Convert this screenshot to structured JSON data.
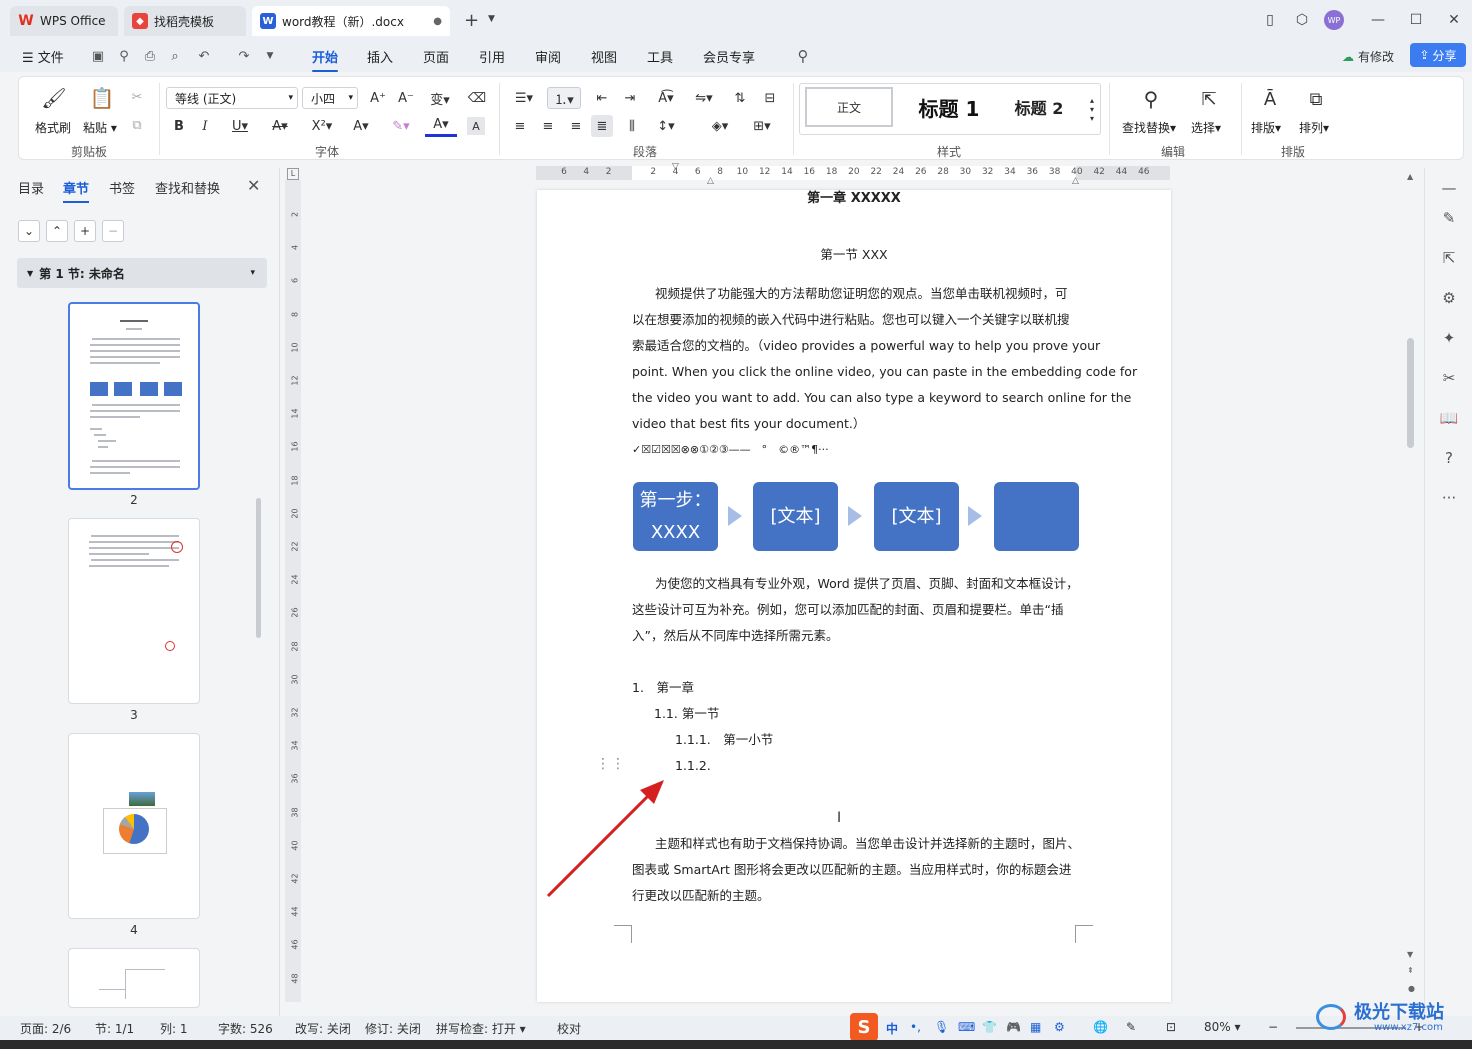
{
  "tabs": [
    {
      "label": "WPS Office",
      "logo": "W"
    },
    {
      "label": "找稻壳模板"
    },
    {
      "label": "word教程（新）.docx",
      "logo": "W"
    }
  ],
  "avatar": "WP",
  "menu": {
    "file": "文件",
    "items": [
      "开始",
      "插入",
      "页面",
      "引用",
      "审阅",
      "视图",
      "工具",
      "会员专享"
    ],
    "has_changes": "有修改",
    "share": "分享"
  },
  "ribbon": {
    "clipboard": {
      "format_painter": "格式刷",
      "paste": "粘贴",
      "section": "剪贴板"
    },
    "font": {
      "name": "等线 (正文)",
      "size": "小四",
      "section": "字体"
    },
    "paragraph": {
      "section": "段落"
    },
    "styles": {
      "normal": "正文",
      "heading1": "标题 1",
      "heading2": "标题 2",
      "section": "样式"
    },
    "edit": {
      "find_replace": "查找替换",
      "select": "选择",
      "section": "编辑"
    },
    "layout": {
      "typeset": "排版",
      "arrange": "排列",
      "section": "排版"
    }
  },
  "leftpanel": {
    "tabs": [
      "目录",
      "章节",
      "书签",
      "查找和替换"
    ],
    "section_title": "第 1 节: 未命名",
    "pages": [
      "2",
      "3",
      "4"
    ]
  },
  "ruler": {
    "h": [
      "6",
      "4",
      "2",
      "",
      "2",
      "4",
      "6",
      "8",
      "10",
      "12",
      "14",
      "16",
      "18",
      "20",
      "22",
      "24",
      "26",
      "28",
      "30",
      "32",
      "34",
      "36",
      "38",
      "40",
      "42",
      "44",
      "46"
    ],
    "v": [
      "2",
      "4",
      "6",
      "8",
      "10",
      "12",
      "14",
      "16",
      "18",
      "20",
      "22",
      "24",
      "26",
      "28",
      "30",
      "32",
      "34",
      "36",
      "38",
      "40",
      "42",
      "44",
      "46",
      "48"
    ]
  },
  "document": {
    "chapter": "第一章  XXXXX",
    "section": "第一节 XXX",
    "para1": [
      "视频提供了功能强大的方法帮助您证明您的观点。当您单击联机视频时，可",
      "以在想要添加的视频的嵌入代码中进行粘贴。您也可以键入一个关键字以联机搜",
      "索最适合您的文档的。（video provides a powerful way to help you prove your",
      "point. When you click the online video, you can paste in the embedding code for",
      "the video you want to add. You can also type a keyword to search online for the",
      "video that best fits your document.）"
    ],
    "symbols": "✓☒☑☒☒⊗⊗①②③——　°　©®™¶···",
    "flow": [
      "第一步：\nXXXX",
      "[文本]",
      "[文本]",
      ""
    ],
    "para2": [
      "为使您的文档具有专业外观，Word 提供了页眉、页脚、封面和文本框设计，",
      "这些设计可互为补充。例如，您可以添加匹配的封面、页眉和提要栏。单击“插",
      "入”，然后从不同库中选择所需元素。"
    ],
    "list": [
      {
        "num": "1.",
        "text": "第一章"
      },
      {
        "num": "1.1.",
        "text": "第一节"
      },
      {
        "num": "1.1.1.",
        "text": "第一小节"
      },
      {
        "num": "1.1.2.",
        "text": ""
      }
    ],
    "para3": [
      "主题和样式也有助于文档保持协调。当您单击设计并选择新的主题时，图片、",
      "图表或 SmartArt 图形将会更改以匹配新的主题。当应用样式时，你的标题会进",
      "行更改以匹配新的主题。"
    ]
  },
  "status": {
    "page": "页面: 2/6",
    "section": "节: 1/1",
    "column": "列: 1",
    "words": "字数: 526",
    "rewrite": "改写: 关闭",
    "revise": "修订: 关闭",
    "spell": "拼写检查: 打开",
    "proof": "校对",
    "zoom": "80%"
  },
  "watermark": "极光下载站",
  "watermark_url": "www.xz7.com"
}
